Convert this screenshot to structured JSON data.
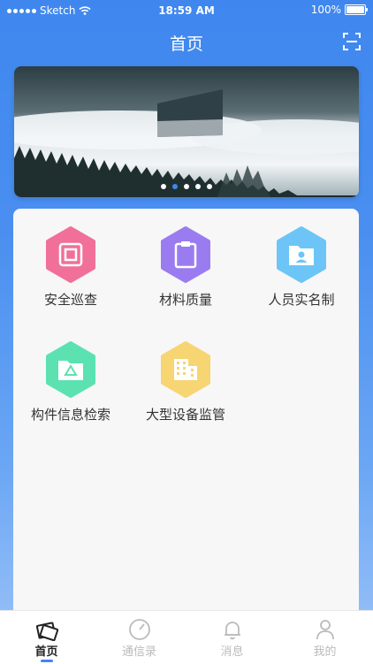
{
  "status_bar": {
    "carrier": "Sketch",
    "time": "18:59 AM",
    "battery": "100%"
  },
  "nav": {
    "title": "首页",
    "scan_icon": "scan-icon"
  },
  "banner": {
    "slide_count": 5,
    "active_index": 1
  },
  "grid": [
    {
      "label": "安全巡查",
      "color": "#f0709a",
      "icon": "security-patrol-icon"
    },
    {
      "label": "材料质量",
      "color": "#9a7cf0",
      "icon": "clipboard-icon"
    },
    {
      "label": "人员实名制",
      "color": "#6cc5f6",
      "icon": "person-folder-icon"
    },
    {
      "label": "构件信息检索",
      "color": "#5be2b0",
      "icon": "recycle-folder-icon"
    },
    {
      "label": "大型设备监管",
      "color": "#f6d572",
      "icon": "building-icon"
    }
  ],
  "tabs": [
    {
      "label": "首页",
      "icon": "home-icon",
      "active": true
    },
    {
      "label": "通信录",
      "icon": "compass-icon",
      "active": false
    },
    {
      "label": "消息",
      "icon": "bell-icon",
      "active": false
    },
    {
      "label": "我的",
      "icon": "user-icon",
      "active": false
    }
  ],
  "colors": {
    "accent": "#3f87ef",
    "inactive_tab": "#bbbbbb"
  }
}
